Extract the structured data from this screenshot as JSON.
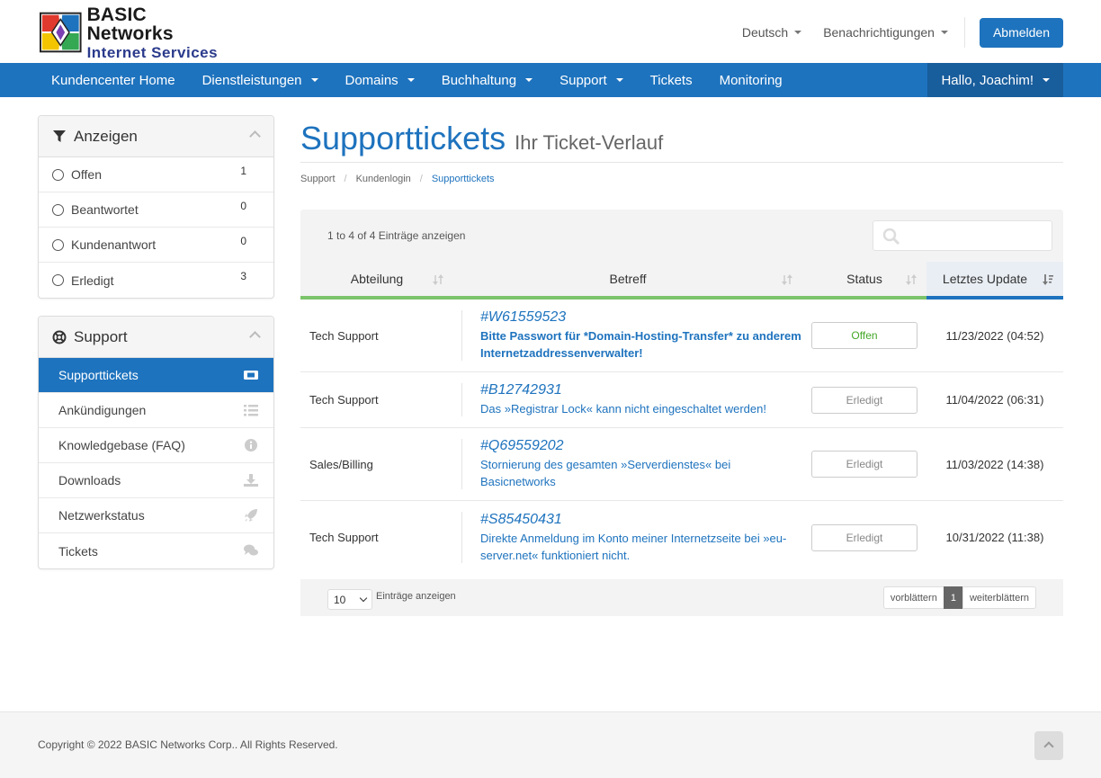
{
  "brand": {
    "line1": "BASIC Networks",
    "line2": "Internet Services"
  },
  "topbar": {
    "language": "Deutsch",
    "notifications": "Benachrichtigungen",
    "logout": "Abmelden"
  },
  "nav": {
    "items": [
      {
        "label": "Kundencenter Home",
        "dropdown": false
      },
      {
        "label": "Dienstleistungen",
        "dropdown": true
      },
      {
        "label": "Domains",
        "dropdown": true
      },
      {
        "label": "Buchhaltung",
        "dropdown": true
      },
      {
        "label": "Support",
        "dropdown": true
      },
      {
        "label": "Tickets",
        "dropdown": false
      },
      {
        "label": "Monitoring",
        "dropdown": false
      }
    ],
    "user": "Hallo, Joachim!"
  },
  "filter_panel": {
    "title": "Anzeigen",
    "items": [
      {
        "label": "Offen",
        "count": "1"
      },
      {
        "label": "Beantwortet",
        "count": "0"
      },
      {
        "label": "Kundenantwort",
        "count": "0"
      },
      {
        "label": "Erledigt",
        "count": "3"
      }
    ]
  },
  "support_panel": {
    "title": "Support",
    "items": [
      {
        "label": "Supporttickets",
        "icon": "ticket-icon",
        "active": true
      },
      {
        "label": "Ankündigungen",
        "icon": "list-icon",
        "active": false
      },
      {
        "label": "Knowledgebase (FAQ)",
        "icon": "info-icon",
        "active": false
      },
      {
        "label": "Downloads",
        "icon": "download-icon",
        "active": false
      },
      {
        "label": "Netzwerkstatus",
        "icon": "rocket-icon",
        "active": false
      },
      {
        "label": "Tickets",
        "icon": "comments-icon",
        "active": false
      }
    ]
  },
  "page": {
    "title": "Supporttickets",
    "subtitle": "Ihr Ticket-Verlauf",
    "breadcrumb": [
      "Support",
      "Kundenlogin",
      "Supporttickets"
    ]
  },
  "table": {
    "info": "1 to 4 of 4 Einträge anzeigen",
    "search_placeholder": "",
    "columns": [
      "Abteilung",
      "Betreff",
      "Status",
      "Letztes Update"
    ],
    "rows": [
      {
        "dept": "Tech Support",
        "id": "#W61559523",
        "subject": "Bitte Passwort für *Domain-Hosting-Transfer* zu anderem Internetzaddressenverwalter!",
        "status": "Offen",
        "date": "11/23/2022 (04:52)"
      },
      {
        "dept": "Tech Support",
        "id": "#B12742931",
        "subject": "Das »Registrar Lock« kann nicht eingeschaltet werden!",
        "status": "Erledigt",
        "date": "11/04/2022 (06:31)"
      },
      {
        "dept": "Sales/Billing",
        "id": "#Q69559202",
        "subject": "Stornierung des gesamten »Serverdienstes« bei Basicnetworks",
        "status": "Erledigt",
        "date": "11/03/2022 (14:38)"
      },
      {
        "dept": "Tech Support",
        "id": "#S85450431",
        "subject": "Direkte Anmeldung im Konto meiner Internetzseite bei »eu-server.net« funktioniert nicht.",
        "status": "Erledigt",
        "date": "10/31/2022 (11:38)"
      }
    ],
    "page_length": "10",
    "page_length_label": "Einträge anzeigen",
    "pager": {
      "prev": "vorblättern",
      "current": "1",
      "next": "weiterblättern"
    }
  },
  "footer": {
    "copyright": "Copyright © 2022 BASIC Networks Corp.. All Rights Reserved."
  },
  "colors": {
    "primary": "#1e73be",
    "open": "#44a828",
    "sort_bar": "#7cc46a"
  }
}
